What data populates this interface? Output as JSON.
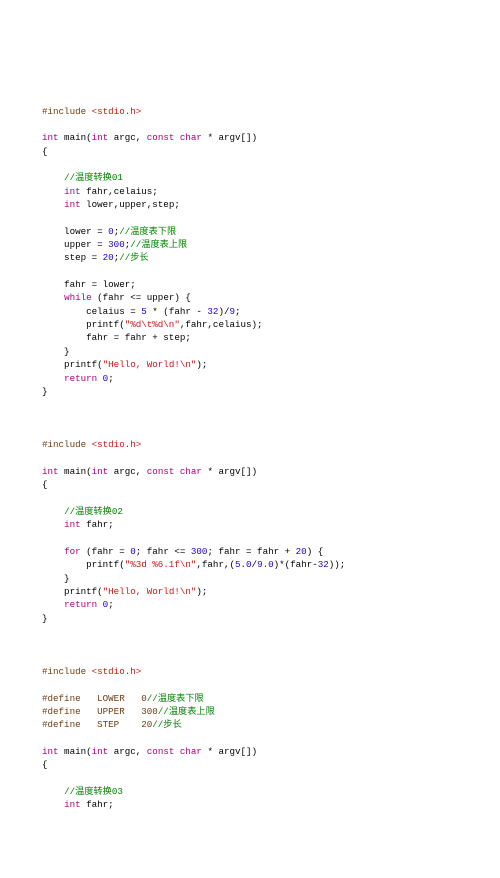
{
  "code": {
    "lines": [
      [
        [
          "plain",
          ""
        ]
      ],
      [
        [
          "k-preproc",
          "#include "
        ],
        [
          "k-string",
          "<stdio.h>"
        ]
      ],
      [
        [
          "plain",
          ""
        ]
      ],
      [
        [
          "k-type",
          "int"
        ],
        [
          "plain",
          " main("
        ],
        [
          "k-type",
          "int"
        ],
        [
          "plain",
          " argc, "
        ],
        [
          "k-type",
          "const"
        ],
        [
          "plain",
          " "
        ],
        [
          "k-type",
          "char"
        ],
        [
          "plain",
          " * argv[])"
        ]
      ],
      [
        [
          "plain",
          "{"
        ]
      ],
      [
        [
          "plain",
          ""
        ]
      ],
      [
        [
          "plain",
          "    "
        ],
        [
          "k-comment",
          "//温度转换01"
        ]
      ],
      [
        [
          "plain",
          "    "
        ],
        [
          "k-type",
          "int"
        ],
        [
          "plain",
          " fahr,celaius;"
        ]
      ],
      [
        [
          "plain",
          "    "
        ],
        [
          "k-type",
          "int"
        ],
        [
          "plain",
          " lower,upper,step;"
        ]
      ],
      [
        [
          "plain",
          ""
        ]
      ],
      [
        [
          "plain",
          "    lower = "
        ],
        [
          "k-num",
          "0"
        ],
        [
          "plain",
          ";"
        ],
        [
          "k-comment",
          "//温度表下限"
        ]
      ],
      [
        [
          "plain",
          "    upper = "
        ],
        [
          "k-num",
          "300"
        ],
        [
          "plain",
          ";"
        ],
        [
          "k-comment",
          "//温度表上限"
        ]
      ],
      [
        [
          "plain",
          "    step = "
        ],
        [
          "k-num",
          "20"
        ],
        [
          "plain",
          ";"
        ],
        [
          "k-comment",
          "//步长"
        ]
      ],
      [
        [
          "plain",
          ""
        ]
      ],
      [
        [
          "plain",
          "    fahr = lower;"
        ]
      ],
      [
        [
          "plain",
          "    "
        ],
        [
          "k-type",
          "while"
        ],
        [
          "plain",
          " (fahr <= upper) {"
        ]
      ],
      [
        [
          "plain",
          "        celaius = "
        ],
        [
          "k-num",
          "5"
        ],
        [
          "plain",
          " * (fahr - "
        ],
        [
          "k-num",
          "32"
        ],
        [
          "plain",
          ")/"
        ],
        [
          "k-num",
          "9"
        ],
        [
          "plain",
          ";"
        ]
      ],
      [
        [
          "plain",
          "        printf("
        ],
        [
          "k-string",
          "\"%d\\t%d\\n\""
        ],
        [
          "plain",
          ",fahr,celaius);"
        ]
      ],
      [
        [
          "plain",
          "        fahr = fahr + step;"
        ]
      ],
      [
        [
          "plain",
          "    }"
        ]
      ],
      [
        [
          "plain",
          "    printf("
        ],
        [
          "k-string",
          "\"Hello, World!\\n\""
        ],
        [
          "plain",
          ");"
        ]
      ],
      [
        [
          "plain",
          "    "
        ],
        [
          "k-type",
          "return"
        ],
        [
          "plain",
          " "
        ],
        [
          "k-num",
          "0"
        ],
        [
          "plain",
          ";"
        ]
      ],
      [
        [
          "plain",
          "}"
        ]
      ],
      [
        [
          "plain",
          ""
        ]
      ],
      [
        [
          "plain",
          ""
        ]
      ],
      [
        [
          "plain",
          ""
        ]
      ],
      [
        [
          "k-preproc",
          "#include "
        ],
        [
          "k-string",
          "<stdio.h>"
        ]
      ],
      [
        [
          "plain",
          ""
        ]
      ],
      [
        [
          "k-type",
          "int"
        ],
        [
          "plain",
          " main("
        ],
        [
          "k-type",
          "int"
        ],
        [
          "plain",
          " argc, "
        ],
        [
          "k-type",
          "const"
        ],
        [
          "plain",
          " "
        ],
        [
          "k-type",
          "char"
        ],
        [
          "plain",
          " * argv[])"
        ]
      ],
      [
        [
          "plain",
          "{"
        ]
      ],
      [
        [
          "plain",
          ""
        ]
      ],
      [
        [
          "plain",
          "    "
        ],
        [
          "k-comment",
          "//温度转换02"
        ]
      ],
      [
        [
          "plain",
          "    "
        ],
        [
          "k-type",
          "int"
        ],
        [
          "plain",
          " fahr;"
        ]
      ],
      [
        [
          "plain",
          ""
        ]
      ],
      [
        [
          "plain",
          "    "
        ],
        [
          "k-type",
          "for"
        ],
        [
          "plain",
          " (fahr = "
        ],
        [
          "k-num",
          "0"
        ],
        [
          "plain",
          "; fahr <= "
        ],
        [
          "k-num",
          "300"
        ],
        [
          "plain",
          "; fahr = fahr + "
        ],
        [
          "k-num",
          "20"
        ],
        [
          "plain",
          ") {"
        ]
      ],
      [
        [
          "plain",
          "        printf("
        ],
        [
          "k-string",
          "\"%3d %6.1f\\n\""
        ],
        [
          "plain",
          ",fahr,("
        ],
        [
          "k-num",
          "5.0"
        ],
        [
          "plain",
          "/"
        ],
        [
          "k-num",
          "9.0"
        ],
        [
          "plain",
          ")*(fahr-"
        ],
        [
          "k-num",
          "32"
        ],
        [
          "plain",
          "));"
        ]
      ],
      [
        [
          "plain",
          "    }"
        ]
      ],
      [
        [
          "plain",
          "    printf("
        ],
        [
          "k-string",
          "\"Hello, World!\\n\""
        ],
        [
          "plain",
          ");"
        ]
      ],
      [
        [
          "plain",
          "    "
        ],
        [
          "k-type",
          "return"
        ],
        [
          "plain",
          " "
        ],
        [
          "k-num",
          "0"
        ],
        [
          "plain",
          ";"
        ]
      ],
      [
        [
          "plain",
          "}"
        ]
      ],
      [
        [
          "plain",
          ""
        ]
      ],
      [
        [
          "plain",
          ""
        ]
      ],
      [
        [
          "plain",
          ""
        ]
      ],
      [
        [
          "k-preproc",
          "#include "
        ],
        [
          "k-string",
          "<stdio.h>"
        ]
      ],
      [
        [
          "plain",
          ""
        ]
      ],
      [
        [
          "k-preproc",
          "#define   LOWER   0"
        ],
        [
          "k-comment",
          "//温度表下限"
        ]
      ],
      [
        [
          "k-preproc",
          "#define   UPPER   300"
        ],
        [
          "k-comment",
          "//温度表上限"
        ]
      ],
      [
        [
          "k-preproc",
          "#define   STEP    20"
        ],
        [
          "k-comment",
          "//步长"
        ]
      ],
      [
        [
          "plain",
          ""
        ]
      ],
      [
        [
          "k-type",
          "int"
        ],
        [
          "plain",
          " main("
        ],
        [
          "k-type",
          "int"
        ],
        [
          "plain",
          " argc, "
        ],
        [
          "k-type",
          "const"
        ],
        [
          "plain",
          " "
        ],
        [
          "k-type",
          "char"
        ],
        [
          "plain",
          " * argv[])"
        ]
      ],
      [
        [
          "plain",
          "{"
        ]
      ],
      [
        [
          "plain",
          ""
        ]
      ],
      [
        [
          "plain",
          "    "
        ],
        [
          "k-comment",
          "//温度转换03"
        ]
      ],
      [
        [
          "plain",
          "    "
        ],
        [
          "k-type",
          "int"
        ],
        [
          "plain",
          " fahr;"
        ]
      ]
    ]
  }
}
